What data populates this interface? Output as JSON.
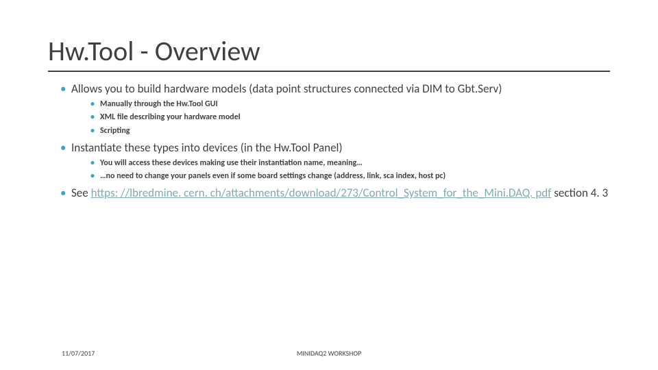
{
  "title": "Hw.Tool - Overview",
  "bullets": {
    "b1": {
      "text": "Allows you to build hardware models (data point structures connected via DIM to Gbt.Serv)",
      "sub": [
        "Manually through the Hw.Tool GUI",
        "XML file describing your hardware model",
        "Scripting"
      ]
    },
    "b2": {
      "text": "Instantiate these types into devices (in the Hw.Tool Panel)",
      "sub": [
        "You will access these devices making use their instantiation name, meaning…",
        "…no need to change your panels even if some board settings change (address, link, sca index, host pc)"
      ]
    },
    "b3": {
      "prefix": "See ",
      "link_text": "https: //lbredmine. cern. ch/attachments/download/273/Control_System_for_the_Mini.DAQ. pdf",
      "suffix": " section 4. 3"
    }
  },
  "footer": {
    "date": "11/07/2017",
    "workshop": "MINIDAQ2 WORKSHOP"
  }
}
